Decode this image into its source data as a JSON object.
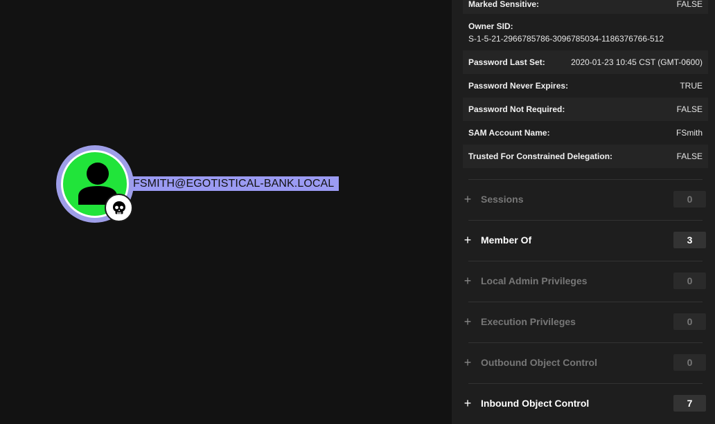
{
  "graph": {
    "node_label": "FSMITH@EGOTISTICAL-BANK.LOCAL",
    "node_icon": "user-icon",
    "badge_icon": "skull-icon",
    "colors": {
      "node_fill": "#21e43a",
      "node_ring": "#9e9ee8",
      "label_highlight": "#9b9bf3"
    }
  },
  "properties": [
    {
      "key": "Marked Sensitive:",
      "value": "FALSE"
    },
    {
      "key": "Owner SID:",
      "value": "S-1-5-21-2966785786-3096785034-1186376766-512"
    },
    {
      "key": "Password Last Set:",
      "value": "2020-01-23 10:45 CST (GMT-0600)"
    },
    {
      "key": "Password Never Expires:",
      "value": "TRUE"
    },
    {
      "key": "Password Not Required:",
      "value": "FALSE"
    },
    {
      "key": "SAM Account Name:",
      "value": "FSmith"
    },
    {
      "key": "Trusted For Constrained Delegation:",
      "value": "FALSE"
    }
  ],
  "sections": [
    {
      "icon": "plus-icon",
      "title": "Sessions",
      "count": "0",
      "active": false
    },
    {
      "icon": "plus-icon",
      "title": "Member Of",
      "count": "3",
      "active": true
    },
    {
      "icon": "plus-icon",
      "title": "Local Admin Privileges",
      "count": "0",
      "active": false
    },
    {
      "icon": "plus-icon",
      "title": "Execution Privileges",
      "count": "0",
      "active": false
    },
    {
      "icon": "plus-icon",
      "title": "Outbound Object Control",
      "count": "0",
      "active": false
    },
    {
      "icon": "plus-icon",
      "title": "Inbound Object Control",
      "count": "7",
      "active": true
    }
  ]
}
